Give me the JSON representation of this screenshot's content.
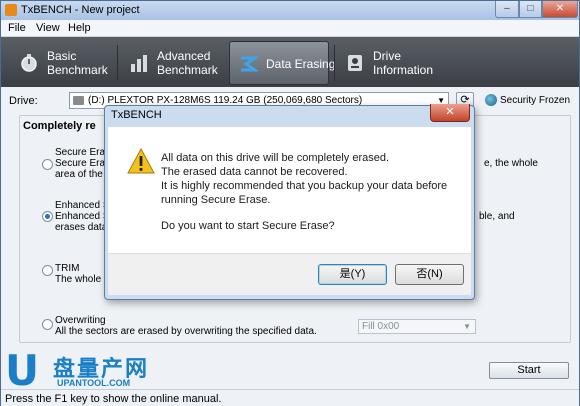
{
  "window": {
    "title": "TxBENCH - New project"
  },
  "window_buttons": {
    "minimize": "–",
    "maximize": "□",
    "close": "✕"
  },
  "menu": {
    "items": [
      "File",
      "View",
      "Help"
    ]
  },
  "nav": {
    "tabs": [
      {
        "line1": "Basic",
        "line2": "Benchmark",
        "icon": "stopwatch-icon"
      },
      {
        "line1": "Advanced",
        "line2": "Benchmark",
        "icon": "bar-chart-icon"
      },
      {
        "label": "Data Erasing",
        "icon": "eraser-icon",
        "active": true
      },
      {
        "line1": "Drive",
        "line2": "Information",
        "icon": "drive-info-icon"
      }
    ]
  },
  "drive": {
    "label": "Drive:",
    "selected": "(D:) PLEXTOR PX-128M6S  119.24 GB (250,069,680 Sectors)",
    "refresh": "⟳",
    "security_status": "Security Frozen"
  },
  "group": {
    "title": "Completely re"
  },
  "options": {
    "secure_erase": {
      "title": "Secure Erase",
      "line1": "Secure Erase",
      "line2": "area of the d",
      "right": "e, the whole"
    },
    "enhanced": {
      "title": "Enhanced Sec",
      "line1": "Enhanced Se",
      "line2": "erases data o",
      "right": "ble, and"
    },
    "trim": {
      "title": "TRIM",
      "line1": "The whole SS"
    },
    "overwriting": {
      "title": "Overwriting",
      "line1": "All the sectors are erased by overwriting the specified data."
    }
  },
  "fill": {
    "value": "Fill 0x00"
  },
  "start_button": "Start",
  "status": "Press the F1 key to show the online manual.",
  "watermark": {
    "logo": "U",
    "text": "盘量产网",
    "url": "UPANTOOL.COM"
  },
  "dialog": {
    "title": "TxBENCH",
    "close": "✕",
    "icon": "warning-icon",
    "lines": [
      "All data on this drive will be completely erased.",
      "The erased data cannot be recovered.",
      "It is highly recommended that you backup your data before",
      "running Secure Erase."
    ],
    "question": "Do you want to start Secure Erase?",
    "yes": "是(Y)",
    "no": "否(N)"
  }
}
